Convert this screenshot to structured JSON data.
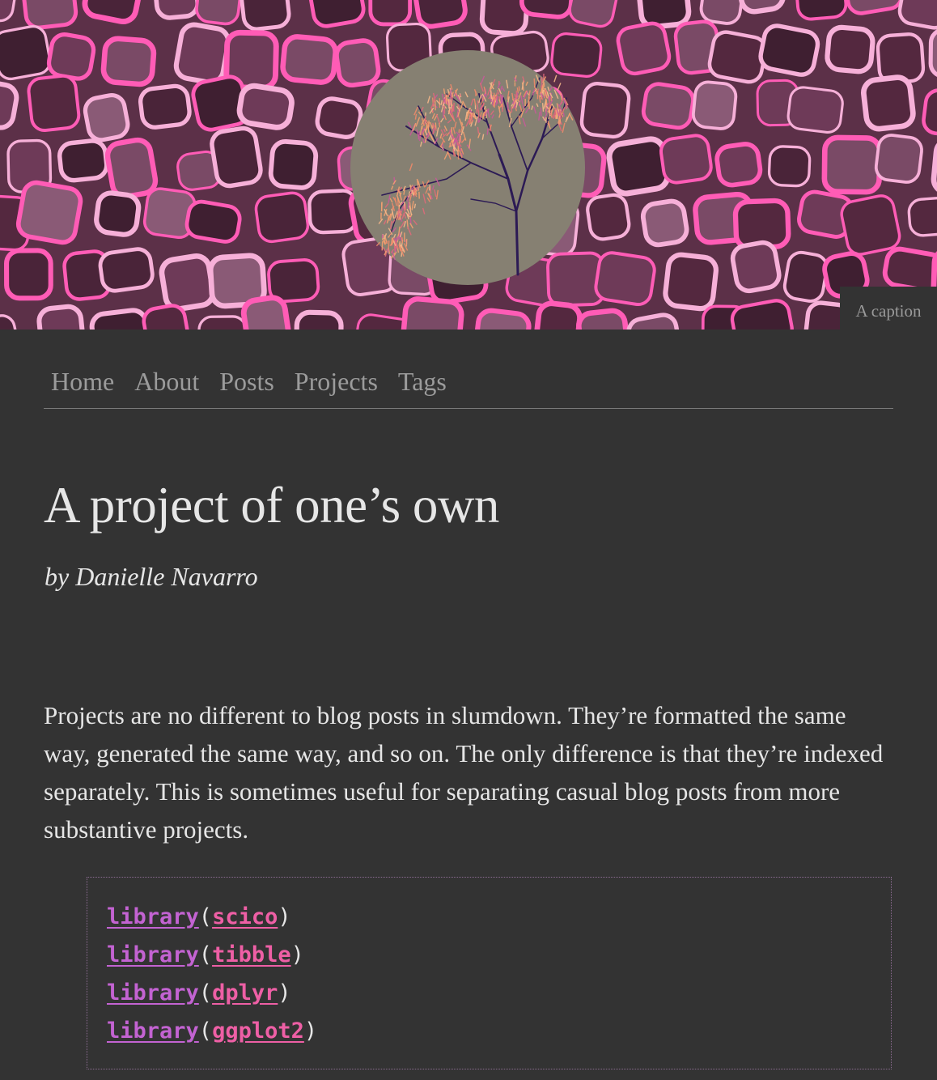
{
  "banner": {
    "caption": "A caption",
    "colors": {
      "background": "#5c3048",
      "lines": "#f6b0d8",
      "circle": "#868072",
      "tree_trunk": "#2c1a55",
      "foliage": "#f5a070"
    }
  },
  "nav": {
    "items": [
      {
        "label": "Home"
      },
      {
        "label": "About"
      },
      {
        "label": "Posts"
      },
      {
        "label": "Projects"
      },
      {
        "label": "Tags"
      }
    ]
  },
  "post": {
    "title": "A project of one’s own",
    "byline": "by Danielle Navarro",
    "body": "Projects are no different to blog posts in slumdown. They’re formatted the same way, generated the same way, and so on. The only difference is that they’re indexed separately. This is sometimes useful for separating casual blog posts from more substantive projects."
  },
  "code": {
    "lines": [
      {
        "fn": "library",
        "open": "(",
        "arg": "scico",
        "close": ")"
      },
      {
        "fn": "library",
        "open": "(",
        "arg": "tibble",
        "close": ")"
      },
      {
        "fn": "library",
        "open": "(",
        "arg": "dplyr",
        "close": ")"
      },
      {
        "fn": "library",
        "open": "(",
        "arg": "ggplot2",
        "close": ")"
      }
    ]
  }
}
